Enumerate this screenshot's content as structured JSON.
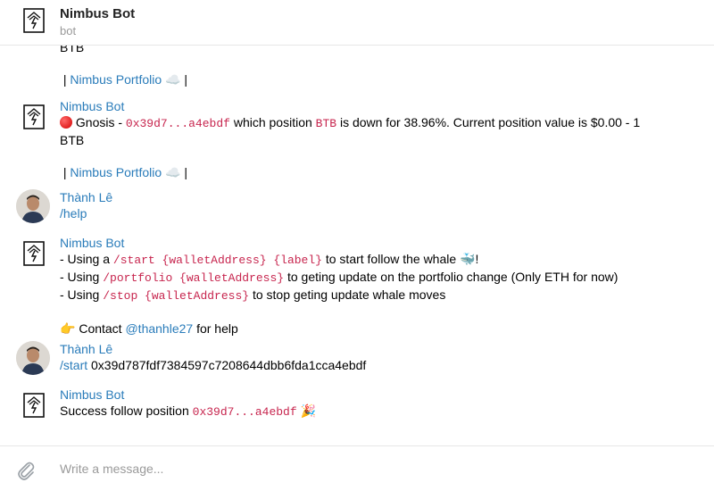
{
  "header": {
    "title": "Nimbus Bot",
    "subtitle": "bot"
  },
  "messages": {
    "m0": {
      "cut_line": "BTB",
      "footer_sep1": " | ",
      "footer_link": "Nimbus Portfolio",
      "footer_emoji": "☁️",
      "footer_sep2": " |"
    },
    "m1": {
      "sender": "Nimbus Bot",
      "text1": " Gnosis - ",
      "address": "0x39d7...a4ebdf",
      "text2": " which position ",
      "token": "BTB",
      "text3": " is down for 38.96%. Current position value is $0.00 - 1",
      "text4": "BTB",
      "footer_sep1": " | ",
      "footer_link": "Nimbus Portfolio",
      "footer_emoji": "☁️",
      "footer_sep2": " |"
    },
    "m2": {
      "sender": "Thành Lê",
      "text": "/help"
    },
    "m3": {
      "sender": "Nimbus Bot",
      "l1_a": "- Using a ",
      "l1_cmd": "/start {walletAddress} {label}",
      "l1_b": " to start follow the whale ",
      "l1_emoji": "🐳",
      "l1_c": "!",
      "l2_a": "- Using ",
      "l2_cmd": "/portfolio {walletAddress}",
      "l2_b": " to geting update on the portfolio change (Only ETH for now)",
      "l3_a": "- Using ",
      "l3_cmd": "/stop {walletAddress}",
      "l3_b": " to stop geting update whale moves",
      "l4_emoji": "👉",
      "l4_a": " Contact ",
      "l4_link": "@thanhle27",
      "l4_b": " for help"
    },
    "m4": {
      "sender": "Thành Lê",
      "cmd": "/start",
      "text": " 0x39d787fdf7384597c7208644dbb6fda1cca4ebdf"
    },
    "m5": {
      "sender": "Nimbus Bot",
      "text": "Success follow position ",
      "address": "0x39d7...a4ebdf",
      "emoji": "🎉"
    }
  },
  "composer": {
    "placeholder": "Write a message..."
  },
  "icons": {
    "bot_logo": "nimbus-logo-icon",
    "attach": "paperclip-icon",
    "status": "red-circle-icon"
  },
  "colors": {
    "link": "#2a7cba",
    "code": "#c7254e",
    "border": "#e7e7e7"
  }
}
